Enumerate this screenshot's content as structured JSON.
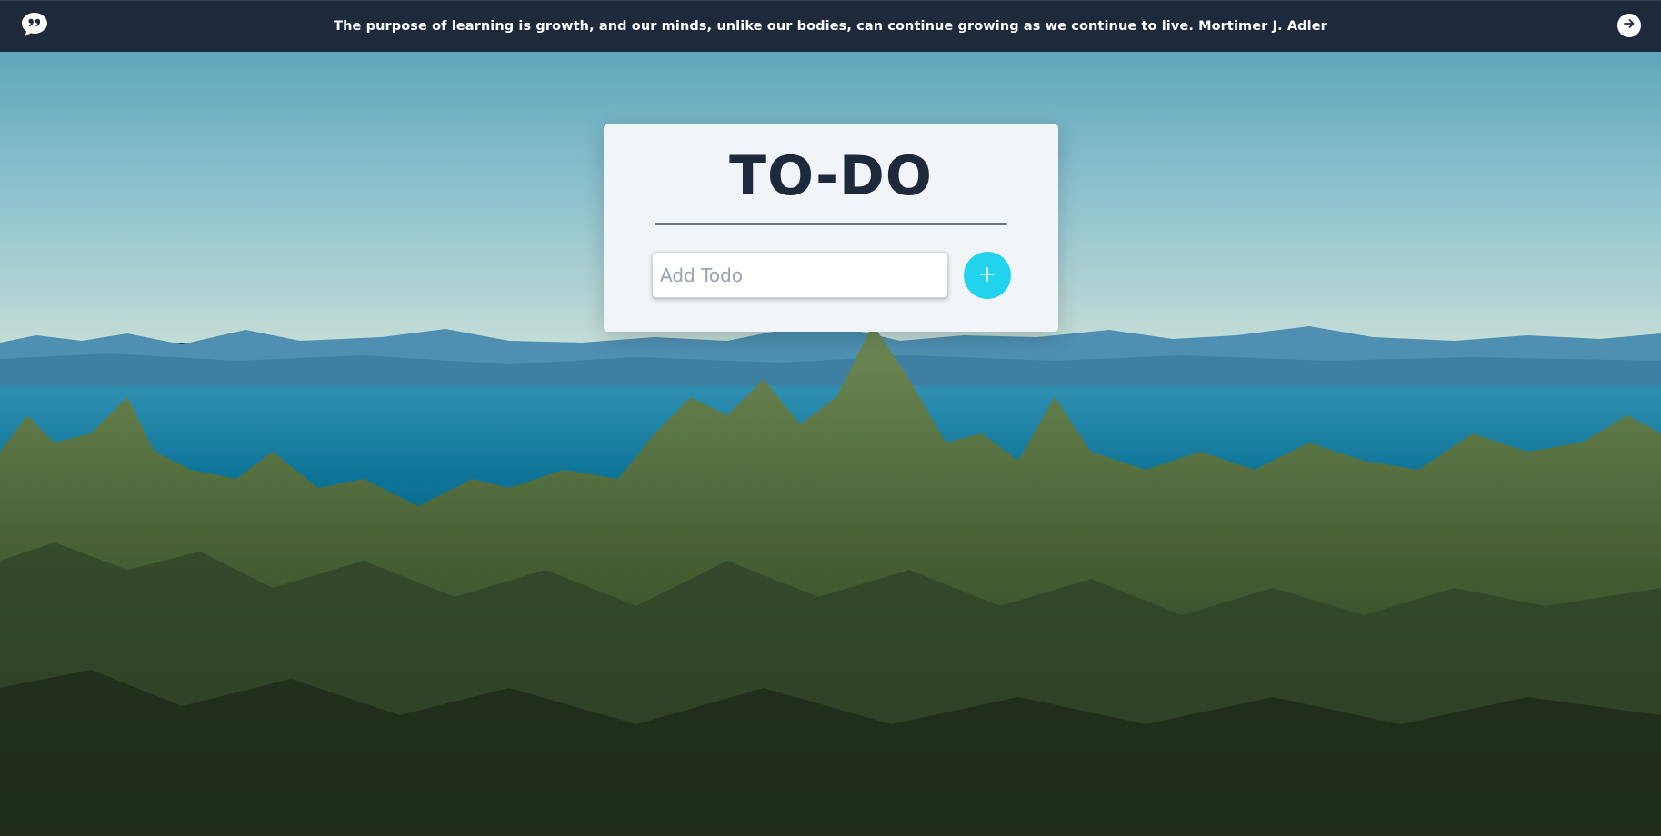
{
  "topbar": {
    "quote": "The purpose of learning is growth, and our minds, unlike our bodies, can continue growing as we continue to live. Mortimer J. Adler",
    "quote_icon": "quote-bubble-icon",
    "next_icon": "arrow-right-circle-icon"
  },
  "todo": {
    "title": "TO-DO",
    "input_placeholder": "Add Todo",
    "input_value": "",
    "add_icon": "plus-icon"
  },
  "colors": {
    "bar_bg": "#1e293b",
    "card_bg": "#f1f5f9",
    "accent": "#22d3ee",
    "title": "#1e293b",
    "divider": "#64748b"
  }
}
